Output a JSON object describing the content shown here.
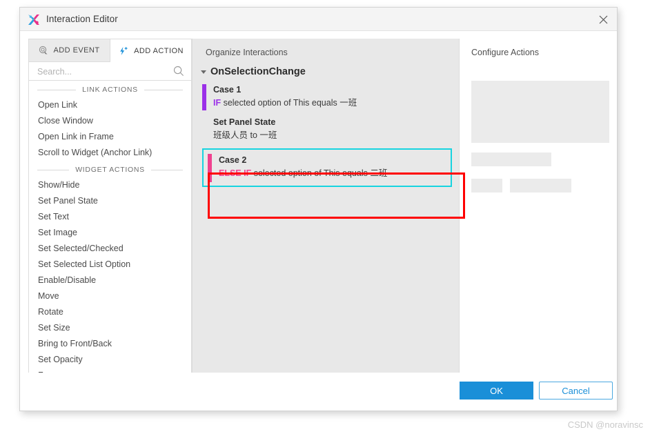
{
  "window": {
    "title": "Interaction Editor",
    "logo_icon": "axure-x-logo-icon",
    "close_icon": "close-icon"
  },
  "left_panel": {
    "tabs": [
      {
        "label": "ADD EVENT",
        "icon": "cursor-target-icon",
        "selected": false
      },
      {
        "label": "ADD ACTION",
        "icon": "lightning-plus-icon",
        "selected": true
      }
    ],
    "search": {
      "placeholder": "Search...",
      "value": "",
      "icon": "search-icon"
    },
    "groups": [
      {
        "heading": "LINK ACTIONS",
        "items": [
          "Open Link",
          "Close Window",
          "Open Link in Frame",
          "Scroll to Widget (Anchor Link)"
        ]
      },
      {
        "heading": "WIDGET ACTIONS",
        "items": [
          "Show/Hide",
          "Set Panel State",
          "Set Text",
          "Set Image",
          "Set Selected/Checked",
          "Set Selected List Option",
          "Enable/Disable",
          "Move",
          "Rotate",
          "Set Size",
          "Bring to Front/Back",
          "Set Opacity",
          "Focus"
        ]
      }
    ]
  },
  "middle_panel": {
    "heading": "Organize Interactions",
    "event": {
      "name": "OnSelectionChange",
      "expanded": true,
      "caret_icon": "chevron-down-icon"
    },
    "case1": {
      "title": "Case 1",
      "condition_keyword": "IF",
      "condition_text": " selected option of This equals 一班",
      "bar_color": "#9b30e8",
      "action_title": "Set Panel State",
      "action_detail": "班级人员 to 一班"
    },
    "case2": {
      "title": "Case 2",
      "condition_keyword": "ELSE IF",
      "condition_text": " selected option of This equals 二班",
      "bar_color": "#f0418f",
      "selected": true,
      "selection_border_color": "#17d4e0"
    },
    "annotation": {
      "name": "red-highlight-rectangle",
      "color": "#ff0000"
    }
  },
  "right_panel": {
    "heading": "Configure Actions",
    "placeholders": [
      {
        "name": "placeholder-large-block"
      },
      {
        "name": "placeholder-field-block"
      },
      {
        "name": "placeholder-small-block"
      },
      {
        "name": "placeholder-medium-block"
      }
    ]
  },
  "footer": {
    "ok_label": "OK",
    "cancel_label": "Cancel",
    "ok_color": "#1a8fd8"
  },
  "watermark": {
    "text": "CSDN @noravinsc"
  }
}
